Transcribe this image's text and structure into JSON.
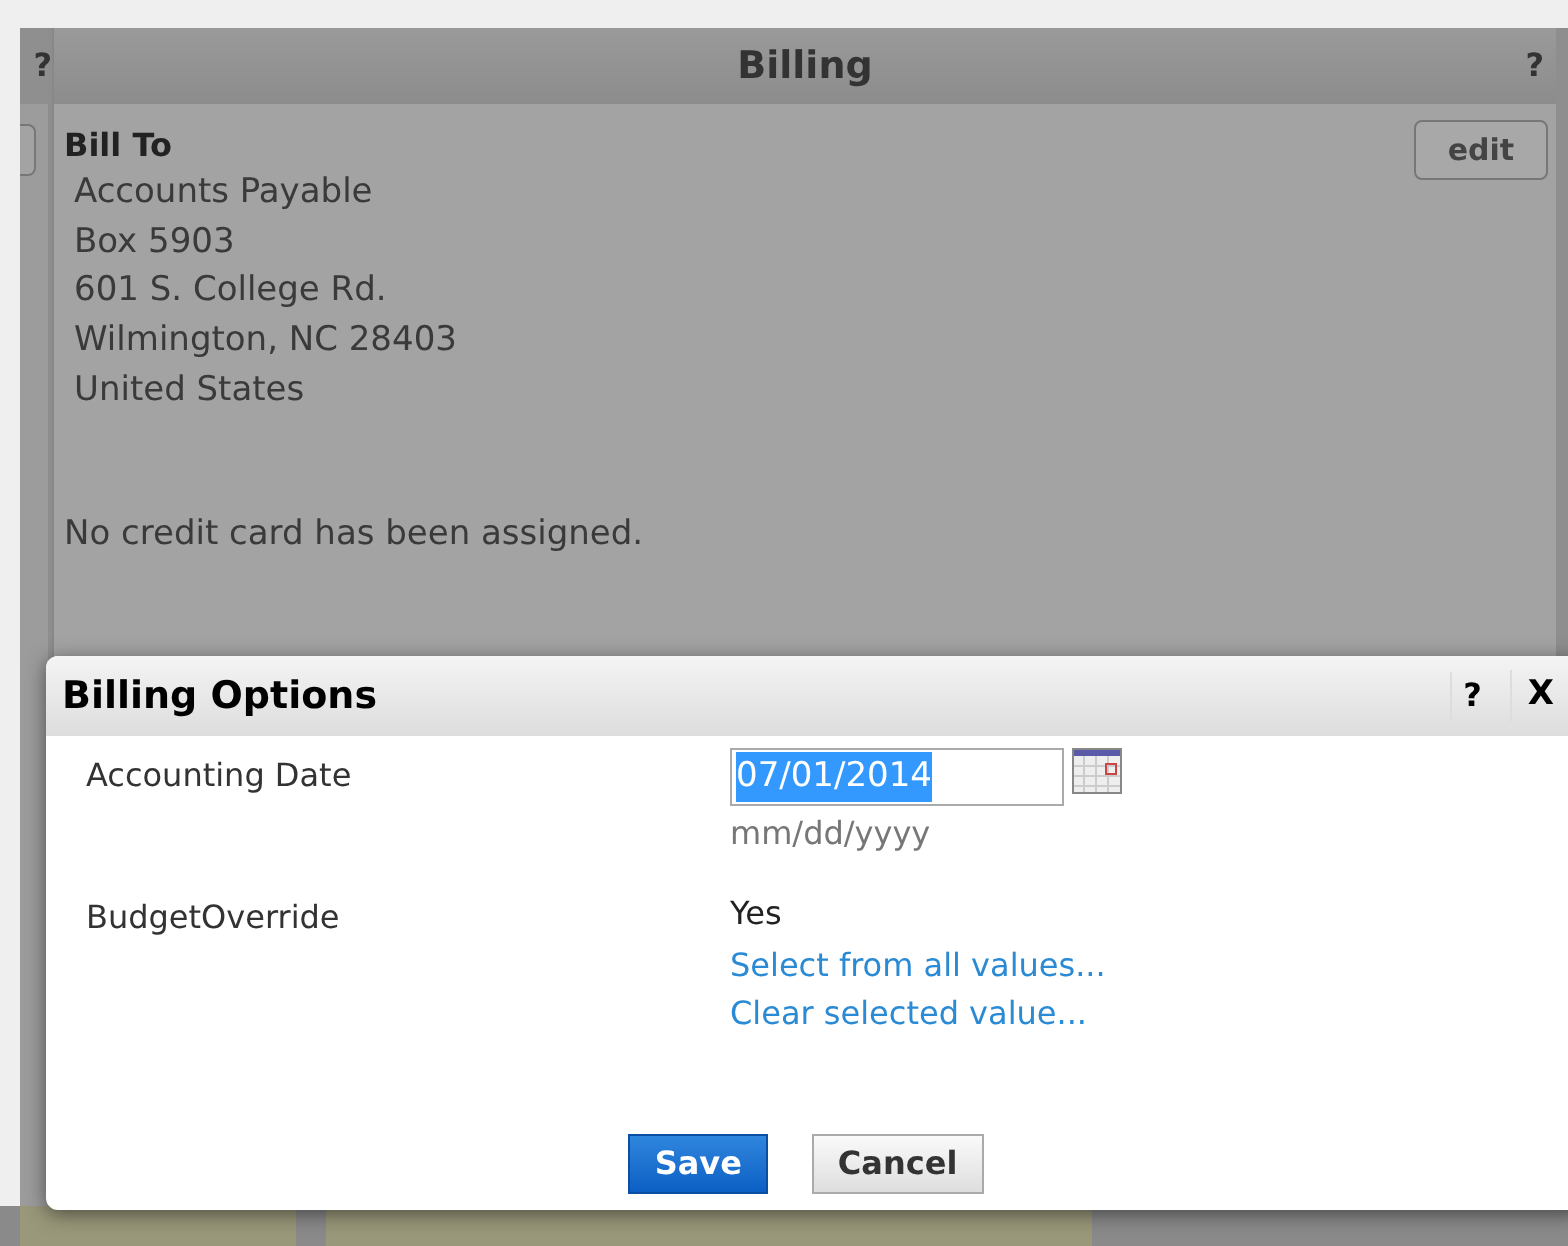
{
  "side_panel": {
    "help": "?"
  },
  "billing_panel": {
    "title": "Billing",
    "help": "?",
    "edit_button": "edit",
    "heading": "Bill To",
    "address": [
      "Accounts Payable",
      "Box 5903",
      "601 S. College Rd.",
      "Wilmington, NC 28403",
      "United States"
    ],
    "credit_card_note": "No credit card has been assigned."
  },
  "dialog": {
    "title": "Billing Options",
    "help": "?",
    "close": "X",
    "fields": [
      {
        "kind": "date",
        "label": "Accounting Date",
        "value": "07/01/2014",
        "selected": true,
        "hint": "mm/dd/yyyy"
      },
      {
        "kind": "choice",
        "label": "BudgetOverride",
        "value": "Yes",
        "links": [
          "Select from all values...",
          "Clear selected value..."
        ]
      }
    ],
    "buttons": [
      {
        "label": "Save",
        "primary": true
      },
      {
        "label": "Cancel",
        "primary": false
      }
    ]
  }
}
